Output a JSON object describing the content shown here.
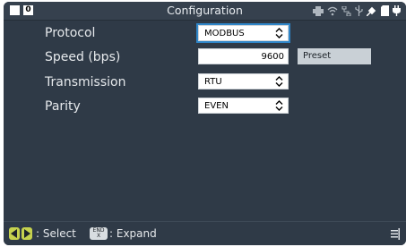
{
  "titlebar": {
    "badge": "0",
    "title": "Configuration",
    "status_icons": [
      "printer-icon",
      "wifi-icon",
      "network-icon",
      "usb-icon",
      "satellite-icon",
      "sd-card-icon",
      "plug-icon"
    ]
  },
  "form": {
    "protocol": {
      "label": "Protocol",
      "value": "MODBUS"
    },
    "speed": {
      "label": "Speed (bps)",
      "value": "9600",
      "preset_label": "Preset"
    },
    "transmission": {
      "label": "Transmission",
      "value": "RTU"
    },
    "parity": {
      "label": "Parity",
      "value": "EVEN"
    }
  },
  "footer": {
    "select_text": ": Select",
    "end_key_top": "END",
    "end_key_bottom": "X",
    "expand_text": ": Expand"
  },
  "colors": {
    "background": "#2f3a47",
    "focus": "#2f86c9",
    "nav_key": "#c6d24e"
  }
}
